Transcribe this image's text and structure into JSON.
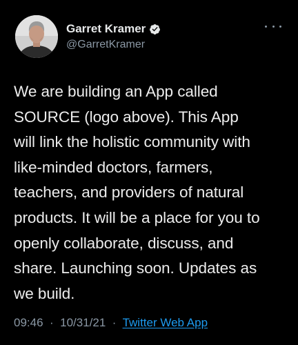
{
  "author": {
    "display_name": "Garret Kramer",
    "handle": "@GarretKramer",
    "verified": true
  },
  "tweet": {
    "lines": [
      "We are building an App called",
      "SOURCE (logo above). This App",
      "will link the holistic community with",
      "like-minded doctors, farmers,",
      "teachers, and providers of natural",
      "products. It will be a place for you to",
      "openly collaborate, discuss, and",
      "share. Launching soon. Updates as",
      "we build."
    ]
  },
  "meta": {
    "time": "09:46",
    "separator": "·",
    "date": "10/31/21",
    "source": "Twitter Web App"
  },
  "icons": {
    "more": "more-options-icon",
    "verified": "verified-badge-icon",
    "avatar": "avatar"
  },
  "colors": {
    "background": "#000000",
    "text": "#e7e9ea",
    "muted": "#8b98a5",
    "link": "#1d9bf0"
  }
}
